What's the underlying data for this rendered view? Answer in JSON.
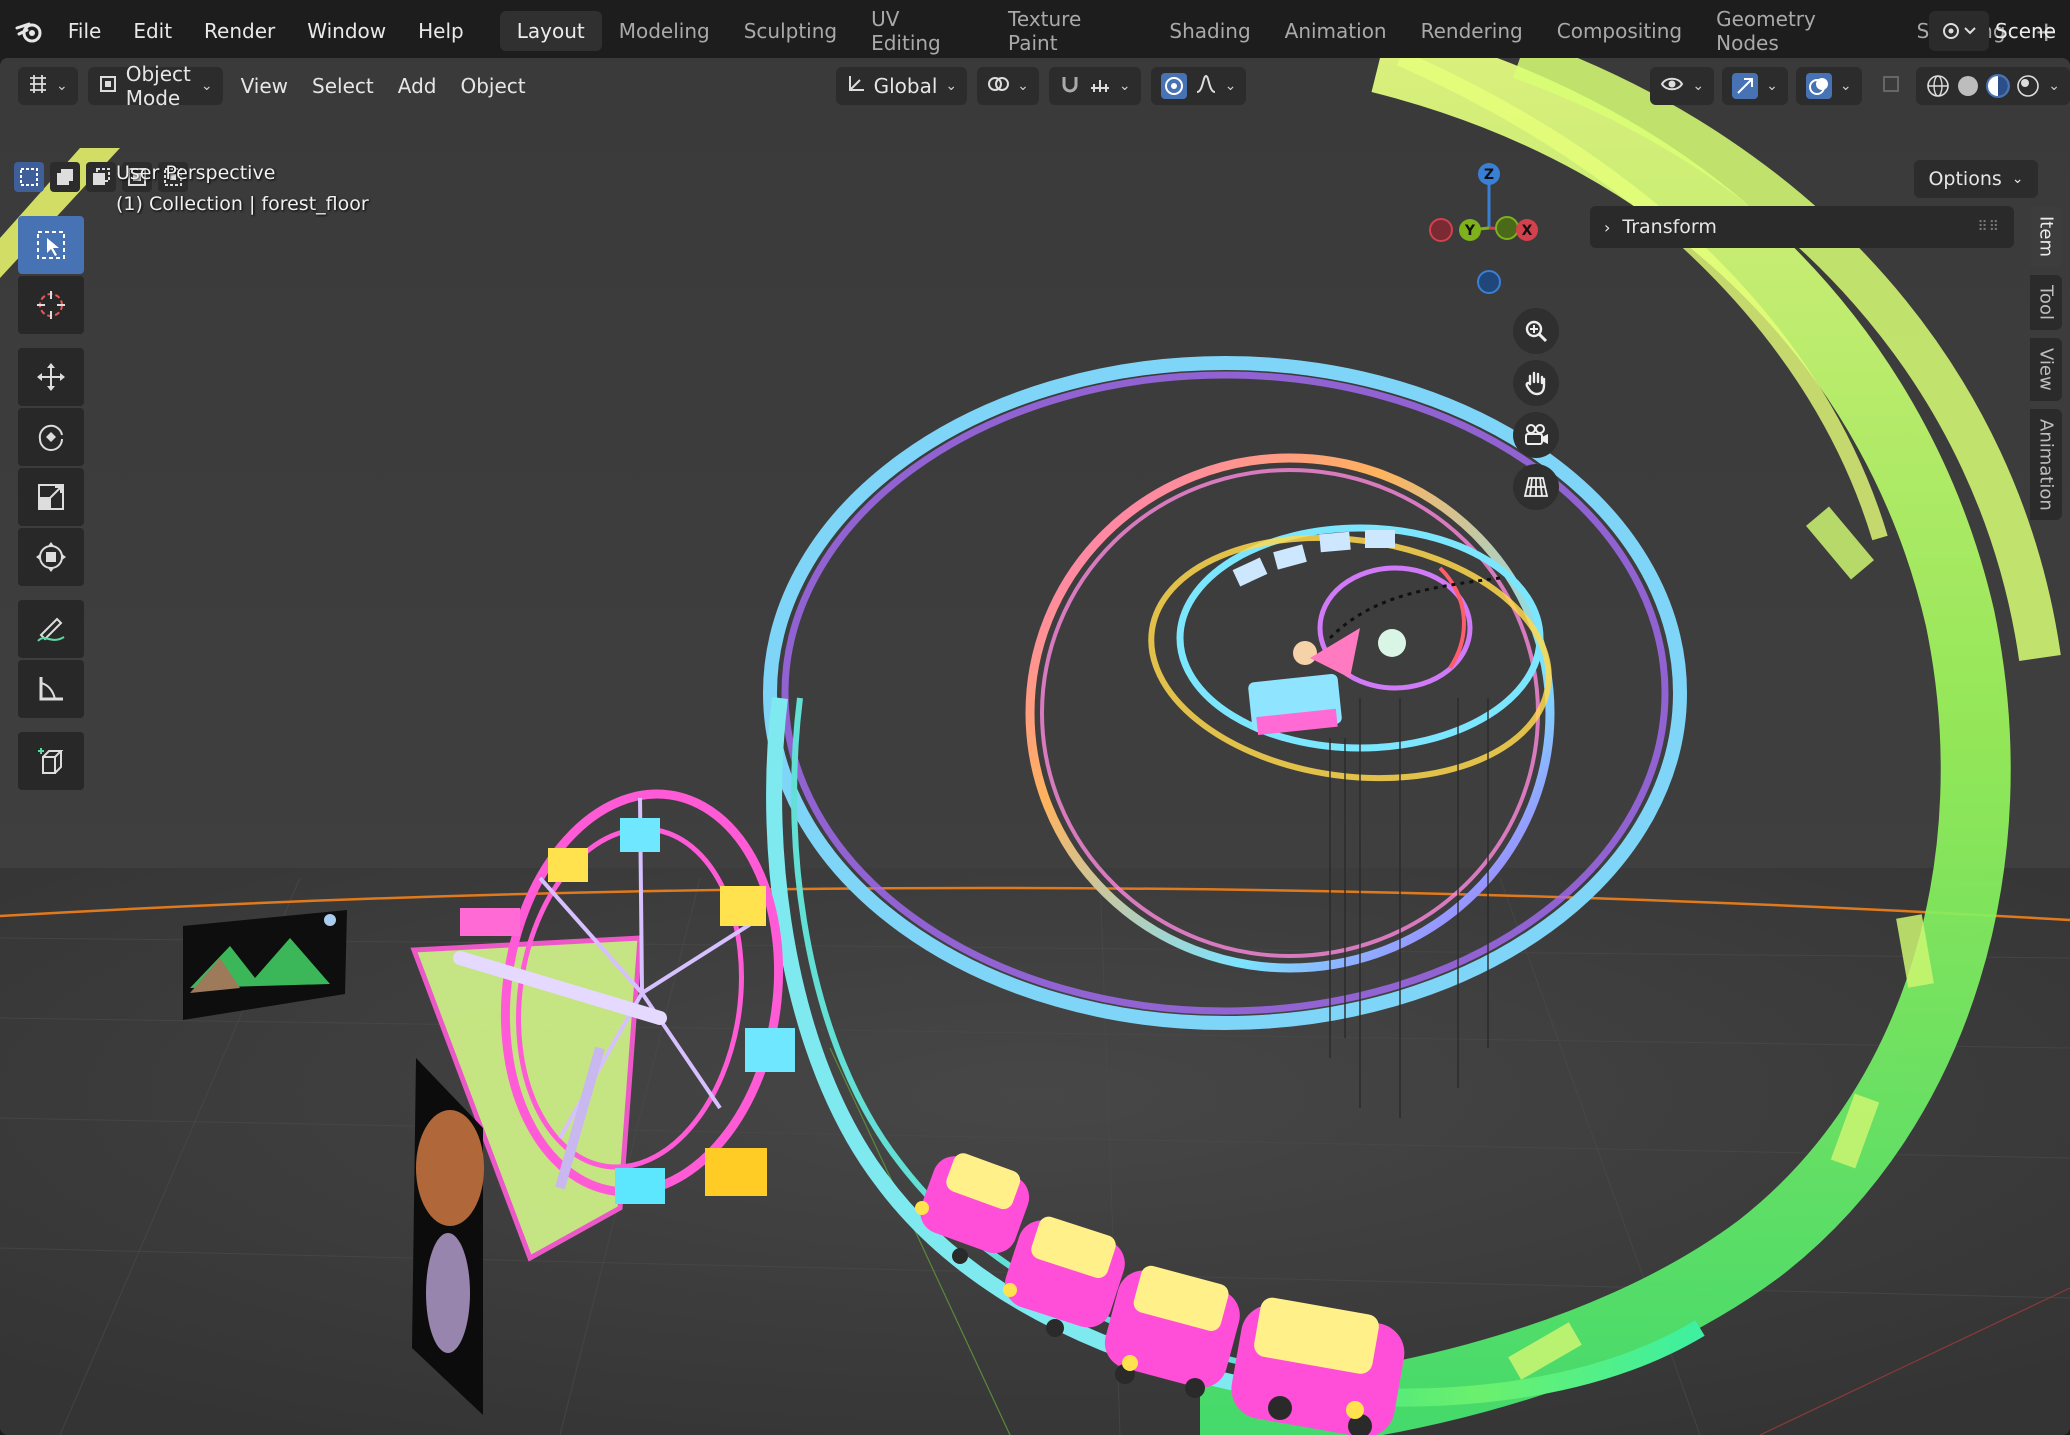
{
  "topbar": {
    "menus": [
      "File",
      "Edit",
      "Render",
      "Window",
      "Help"
    ],
    "workspaces": [
      "Layout",
      "Modeling",
      "Sculpting",
      "UV Editing",
      "Texture Paint",
      "Shading",
      "Animation",
      "Rendering",
      "Compositing",
      "Geometry Nodes",
      "Scripting"
    ],
    "active_workspace": "Layout",
    "add_symbol": "+",
    "scene_label": "Scene"
  },
  "viewport_header": {
    "mode": "Object Mode",
    "menus": [
      "View",
      "Select",
      "Add",
      "Object"
    ],
    "orientation": "Global",
    "options_label": "Options"
  },
  "view_info": {
    "perspective": "User Perspective",
    "collection": "(1) Collection | forest_floor"
  },
  "gizmo": {
    "axes": [
      "Z",
      "Y",
      "X"
    ],
    "colors": {
      "x": "#d3414c",
      "y": "#7fb21a",
      "z": "#3a7fd6"
    }
  },
  "npanel": {
    "tabs": [
      "Item",
      "Tool",
      "View",
      "Animation"
    ],
    "active_tab": "Item",
    "transform_label": "Transform"
  },
  "icons": {
    "toolbar": [
      "select-box-icon",
      "cursor-icon",
      "move-icon",
      "rotate-icon",
      "scale-icon",
      "transform-icon",
      "annotate-icon",
      "measure-icon",
      "add-cube-icon"
    ],
    "nav": [
      "zoom-icon",
      "pan-hand-icon",
      "camera-icon",
      "grid-icon"
    ]
  },
  "colors": {
    "viewport_bg": "#3d3d3d",
    "accent": "#4772b3",
    "horizon": "#e07a1c"
  }
}
